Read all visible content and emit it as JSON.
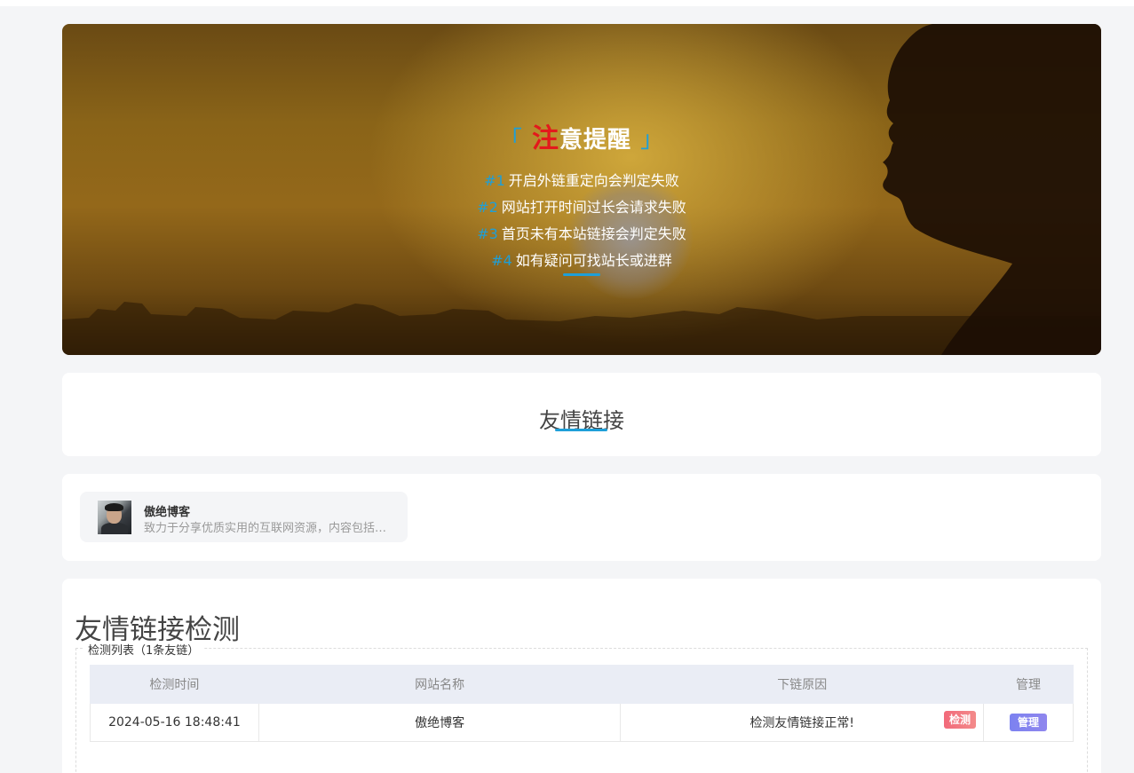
{
  "notice": {
    "title_bracket_left": "「",
    "title_first_char": "注",
    "title_rest": "意提醒",
    "title_bracket_right": "」",
    "items": [
      {
        "num": "#1",
        "text": "开启外链重定向会判定失败"
      },
      {
        "num": "#2",
        "text": "网站打开时间过长会请求失败"
      },
      {
        "num": "#3",
        "text": "首页未有本站链接会判定失败"
      },
      {
        "num": "#4",
        "text": "如有疑问可找站长或进群"
      }
    ]
  },
  "friends": {
    "title": "友情链接",
    "links": [
      {
        "name": "傲绝博客",
        "desc": "致力于分享优质实用的互联网资源，内容包括有..."
      }
    ]
  },
  "check": {
    "title": "友情链接检测",
    "legend": "检测列表（1条友链）",
    "columns": [
      "检测时间",
      "网站名称",
      "下链原因",
      "管理"
    ],
    "rows": [
      {
        "time": "2024-05-16 18:48:41",
        "site": "傲绝博客",
        "reason": "检测友情链接正常!",
        "check_label": "检测",
        "manage_label": "管理"
      }
    ]
  },
  "colors": {
    "accent": "#1e9fd8",
    "highlight_red": "#e3191c",
    "status_ok": "#1b8a1b",
    "badge_check": "#f26a7a",
    "badge_manage": "#7c82f0"
  }
}
